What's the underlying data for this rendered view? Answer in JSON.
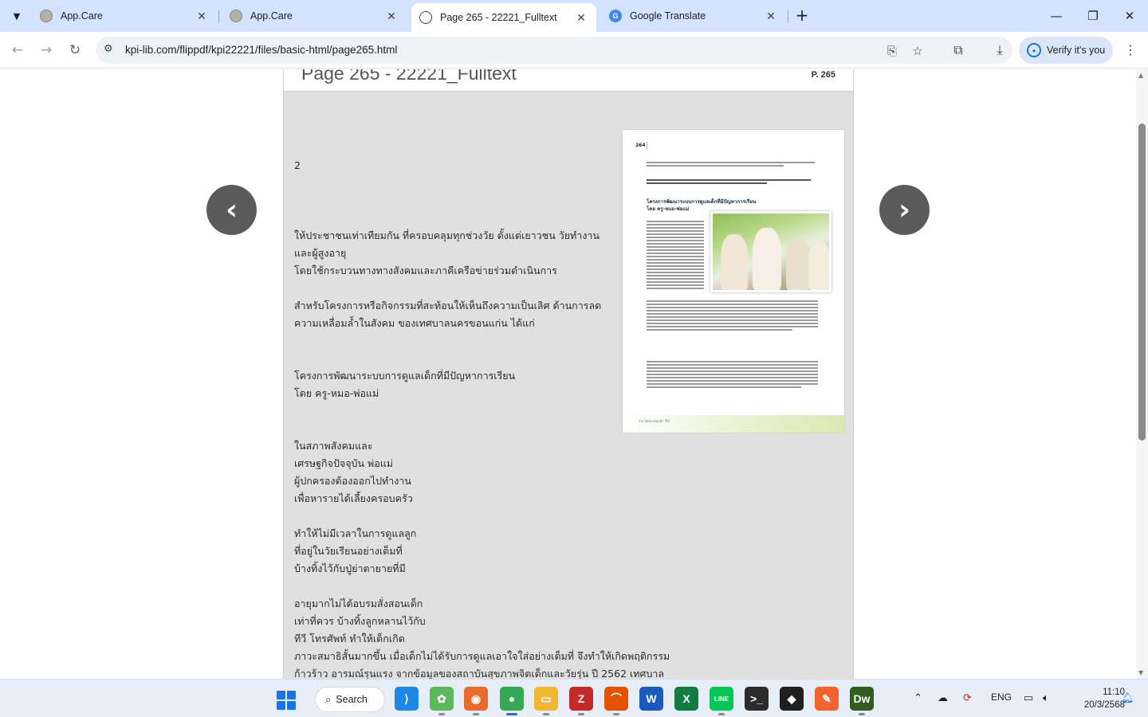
{
  "browser": {
    "tab_search_icon": "chevron-down-icon",
    "tabs": [
      {
        "title": "App.Care",
        "favicon": "app-care-favicon"
      },
      {
        "title": "App.Care",
        "favicon": "app-care-favicon"
      },
      {
        "title": "Page 265 - 22221_Fulltext",
        "favicon": "globe-icon"
      },
      {
        "title": "Google Translate",
        "favicon": "google-translate-icon"
      }
    ],
    "new_tab_label": "+",
    "url": "kpi-lib.com/flippdf/kpi22221/files/basic-html/page265.html",
    "verify_label": "Verify it's you"
  },
  "page": {
    "header_title": "Page 265 - 22221_Fulltext",
    "header_page_label": "P. 265",
    "fulltext_lines": [
      "2",
      "",
      "",
      "",
      "ให้ประชาชนเท่าเทียมกัน  ที่ครอบคลุมทุกช่วงวัย  ตั้งแต่เยาวชน  วัยทำงาน",
      "และผู้สูงอายุ",
      "โดยใช้กระบวนทางทางสังคมและภาคีเครือข่ายร่วมดำเนินการ",
      "",
      "สำหรับโครงการหรือกิจกรรมที่สะท้อนให้เห็นถึงความเป็นเลิศ  ด้านการลด",
      "ความเหลื่อมล้ำในสังคม  ของเทศบาลนครขอนแก่น  ได้แก่",
      "",
      "",
      "โครงการพัฒนาระบบการดูแลเด็กที่มีปัญหาการเรียน",
      "โดย  ครู-หมอ-พ่อแม่",
      "",
      "",
      "ในสภาพสังคมและ",
      "เศรษฐกิจปัจจุบัน  พ่อแม่",
      "ผู้ปกครองต้องออกไปทำงาน",
      "เพื่อหารายได้เลี้ยงครอบครัว",
      "",
      "ทำให้ไม่มีเวลาในการดูแลลูก",
      "ที่อยู่ในวัยเรียนอย่างเต็มที่",
      "บ้างทิ้งไว้กับปู่ย่าตายายที่มี",
      "",
      "อายุมากไม่ได้อบรมสั่งสอนเด็ก",
      "เท่าที่ควร  บ้างทิ้งลูกหลานไว้กับ",
      "ทีวี  โทรศัพท์  ทำให้เด็กเกิด",
      "ภาวะสมาธิสั้นมากขึ้น  เมื่อเด็กไม่ได้รับการดูแลเอาใจใส่อย่างเต็มที่  จึงทำให้เกิดพฤติกรรม",
      "ก้าวร้าว  อารมณ์รุนแรง  จากข้อมูลของสถาบันสุขภาพจิตเด็กและวัยรุ่น  ปี  2562  เทศบาล"
    ],
    "thumbnail": {
      "page_number": "264",
      "heading_line1": "โครงการพัฒนาระบบการดูแลเด็กที่มีปัญหาการเรียน",
      "heading_line2": "โดย ครู-หมอ-พ่อแม่",
      "footer_label": "รางวัลพระปกเกล้า '64"
    },
    "prev_icon": "chevron-left-icon",
    "next_icon": "chevron-right-icon",
    "prev_glyph": "‹",
    "next_glyph": "›"
  },
  "taskbar": {
    "search_label": "Search",
    "language": "ENG",
    "time": "11:10",
    "date": "20/3/2568",
    "apps": [
      {
        "name": "vscode-icon",
        "glyph": "⟩",
        "color": "#1e88e5"
      },
      {
        "name": "leaf-app-icon",
        "glyph": "✿",
        "color": "#5cb85c"
      },
      {
        "name": "firefox-icon",
        "glyph": "◉",
        "color": "#e86b2b"
      },
      {
        "name": "chrome-icon",
        "glyph": "●",
        "color": "#34a853"
      },
      {
        "name": "file-explorer-icon",
        "glyph": "▭",
        "color": "#f2b632"
      },
      {
        "name": "filezilla-icon",
        "glyph": "Z",
        "color": "#c62828"
      },
      {
        "name": "pdf-app-icon",
        "glyph": "⌒",
        "color": "#e65100"
      },
      {
        "name": "word-icon",
        "glyph": "W",
        "color": "#185abd"
      },
      {
        "name": "excel-icon",
        "glyph": "X",
        "color": "#107c41"
      },
      {
        "name": "line-icon",
        "glyph": "LINE",
        "color": "#06c755"
      },
      {
        "name": "terminal-icon",
        "glyph": ">_",
        "color": "#2b2b2b"
      },
      {
        "name": "shield-app-icon",
        "glyph": "◆",
        "color": "#1f1f1f"
      },
      {
        "name": "brush-app-icon",
        "glyph": "✎",
        "color": "#f4622e"
      },
      {
        "name": "dreamweaver-icon",
        "glyph": "Dw",
        "color": "#2e5d1e"
      }
    ]
  }
}
